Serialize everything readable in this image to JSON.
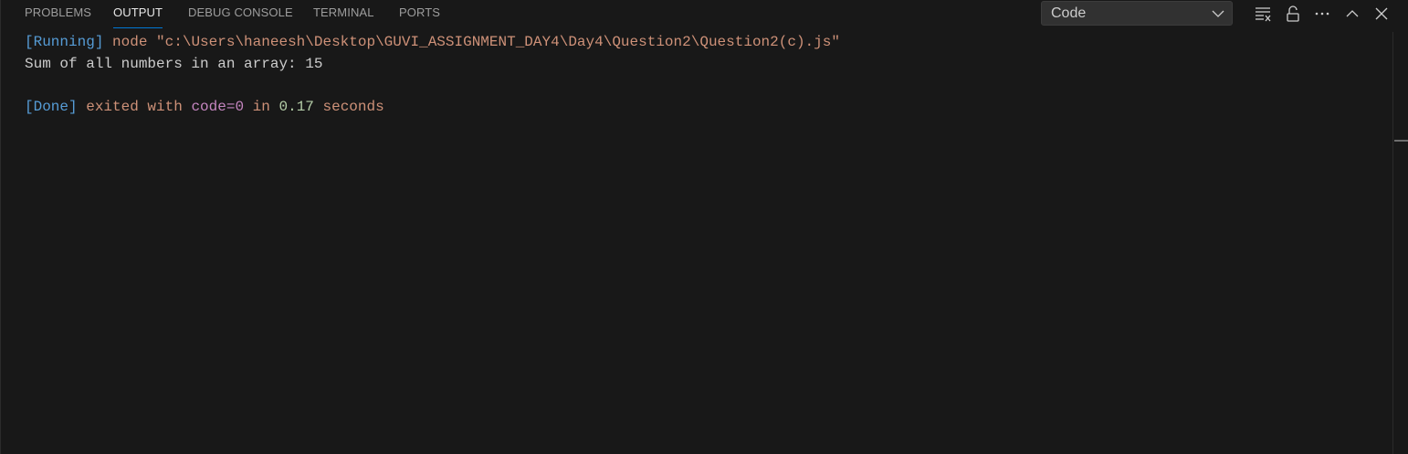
{
  "tabs": [
    {
      "label": "PROBLEMS",
      "active": false
    },
    {
      "label": "OUTPUT",
      "active": true
    },
    {
      "label": "DEBUG CONSOLE",
      "active": false
    },
    {
      "label": "TERMINAL",
      "active": false
    },
    {
      "label": "PORTS",
      "active": false
    }
  ],
  "channel_select": {
    "value": "Code"
  },
  "toolbar": {
    "icons": [
      "clear-output-icon",
      "lock-scroll-icon",
      "more-actions-icon",
      "maximize-panel-icon",
      "close-panel-icon"
    ]
  },
  "output": {
    "running_tag": "[Running]",
    "command": "node \"c:\\Users\\haneesh\\Desktop\\GUVI_ASSIGNMENT_DAY4\\Day4\\Question2\\Question2(c).js\"",
    "result_line": "Sum of all numbers in an array: 15",
    "done_tag": "[Done]",
    "exited_with": "exited with",
    "code": "code=0",
    "in": "in",
    "duration": "0.17",
    "seconds": "seconds"
  },
  "colors": {
    "accent": "#0078d4",
    "tag": "#569cd6",
    "text_orange": "#ce9178",
    "code_purple": "#c586c0",
    "number_green": "#b5cea8"
  }
}
